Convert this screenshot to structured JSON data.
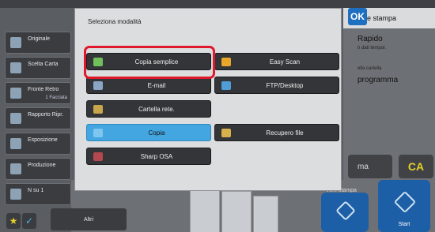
{
  "dialog": {
    "title": "Seleziona modalità",
    "ok_label": "OK",
    "modes": [
      {
        "key": "copia_semplice",
        "label": "Copia semplice",
        "icon": "copy-simple-icon"
      },
      {
        "key": "easy_scan",
        "label": "Easy Scan",
        "icon": "scan-icon"
      },
      {
        "key": "email",
        "label": "E-mail",
        "icon": "mail-icon"
      },
      {
        "key": "ftp_desktop",
        "label": "FTP/Desktop",
        "icon": "desktop-icon"
      },
      {
        "key": "cartella_rete",
        "label": "Cartella rete.",
        "icon": "folder-icon"
      },
      {
        "key": "copia",
        "label": "Copia",
        "icon": "copy-icon",
        "selected": true
      },
      {
        "key": "recupero_file",
        "label": "Recupero file",
        "icon": "file-retrieve-icon"
      },
      {
        "key": "sharp_osa",
        "label": "Sharp OSA",
        "icon": "osa-icon"
      }
    ],
    "highlighted": "Copia semplice"
  },
  "left_menu": [
    {
      "label": "Originale"
    },
    {
      "label": "Scelta Carta"
    },
    {
      "label": "Fronte Retro",
      "sub": "1 Facciata"
    },
    {
      "label": "Rapporto Ripr."
    },
    {
      "label": "Esposizione"
    },
    {
      "label": "Produzione"
    },
    {
      "label": "N su 1"
    }
  ],
  "right_panel": {
    "title_fragment": "e stampa",
    "item1": "Rapido",
    "item1_sub": "n dati tempor.",
    "item2_sub": "ella cartella",
    "item3": "programma",
    "ma_label": "ma",
    "ca_label": "CA",
    "verif_label": "Verif stampa",
    "start_label": "Start"
  },
  "bottom": {
    "altri_label": "Altri"
  },
  "colors": {
    "accent_blue": "#44a6e0",
    "start_blue": "#1d5fa6",
    "highlight_red": "#e0182c",
    "ca_yellow": "#e5cf2a"
  }
}
